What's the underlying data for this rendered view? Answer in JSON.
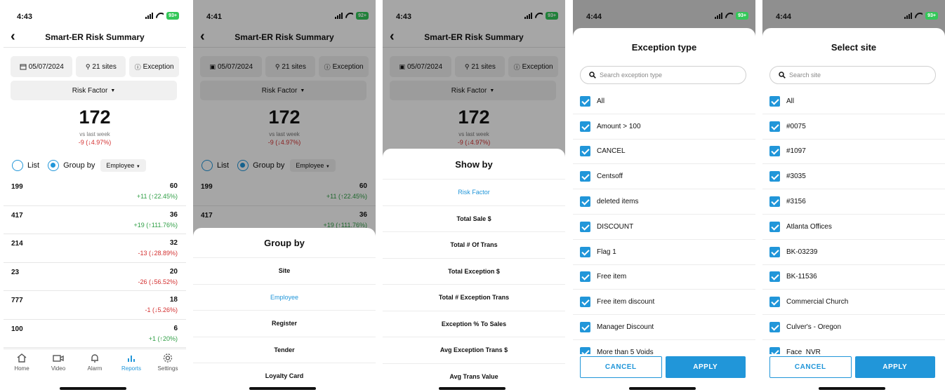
{
  "screen1": {
    "status": {
      "time": "4:43",
      "battery": "93+"
    },
    "nav": {
      "title": "Smart-ER Risk Summary"
    },
    "filters": {
      "date": "05/07/2024",
      "sites": "21 sites",
      "exception": "Exception"
    },
    "risk_factor": "Risk Factor",
    "total": "172",
    "vs_label": "vs last week",
    "delta": "-9 (↓4.97%)",
    "list_label": "List",
    "group_by_label": "Group by",
    "group_by_value": "Employee",
    "rows": [
      {
        "id": "199",
        "count": "60",
        "change": "+11 (↑22.45%)",
        "trend": "up"
      },
      {
        "id": "417",
        "count": "36",
        "change": "+19 (↑111.76%)",
        "trend": "up"
      },
      {
        "id": "214",
        "count": "32",
        "change": "-13 (↓28.89%)",
        "trend": "down"
      },
      {
        "id": "23",
        "count": "20",
        "change": "-26 (↓56.52%)",
        "trend": "down"
      },
      {
        "id": "777",
        "count": "18",
        "change": "-1 (↓5.26%)",
        "trend": "down"
      },
      {
        "id": "100",
        "count": "6",
        "change": "+1 (↑20%)",
        "trend": "up"
      }
    ],
    "tabs": [
      "Home",
      "Video",
      "Alarm",
      "Reports",
      "Settings"
    ],
    "active_tab": "Reports"
  },
  "screen2": {
    "status": {
      "time": "4:41",
      "battery": "92+"
    },
    "nav": {
      "title": "Smart-ER Risk Summary"
    },
    "filters": {
      "date": "05/07/2024",
      "sites": "21 sites",
      "exception": "Exception"
    },
    "risk_factor": "Risk Factor",
    "total": "172",
    "vs_label": "vs last week",
    "delta": "-9 (↓4.97%)",
    "list_label": "List",
    "group_by_label": "Group by",
    "group_by_value": "Employee",
    "rows": [
      {
        "id": "199",
        "count": "60",
        "change": "+11 (↑22.45%)",
        "trend": "up"
      },
      {
        "id": "417",
        "count": "36",
        "change": "+19 (↑111.76%)",
        "trend": "up"
      }
    ],
    "sheet": {
      "title": "Group by",
      "options": [
        "Site",
        "Employee",
        "Register",
        "Tender",
        "Loyalty Card"
      ],
      "selected": "Employee"
    }
  },
  "screen3": {
    "status": {
      "time": "4:43",
      "battery": "93+"
    },
    "nav": {
      "title": "Smart-ER Risk Summary"
    },
    "filters": {
      "date": "05/07/2024",
      "sites": "21 sites",
      "exception": "Exception"
    },
    "risk_factor": "Risk Factor",
    "total": "172",
    "vs_label": "vs last week",
    "delta": "-9 (↓4.97%)",
    "sheet": {
      "title": "Show by",
      "options": [
        "Risk Factor",
        "Total Sale $",
        "Total # Of Trans",
        "Total Exception $",
        "Total # Exception Trans",
        "Exception % To Sales",
        "Avg Exception Trans $",
        "Avg Trans Value"
      ],
      "selected": "Risk Factor"
    }
  },
  "screen4": {
    "status": {
      "time": "4:44",
      "battery": "93+"
    },
    "title": "Exception type",
    "search_placeholder": "Search exception type",
    "items": [
      "All",
      "Amount > 100",
      "CANCEL",
      "Centsoff",
      "deleted items",
      "DISCOUNT",
      "Flag 1",
      "Free item",
      "Free item discount",
      "Manager Discount",
      "More than 5 Voids"
    ],
    "cancel": "CANCEL",
    "apply": "APPLY"
  },
  "screen5": {
    "status": {
      "time": "4:44",
      "battery": "93+"
    },
    "title": "Select site",
    "search_placeholder": "Search site",
    "items": [
      "All",
      "#0075",
      "#1097",
      "#3035",
      "#3156",
      "Atlanta Offices",
      "BK-03239",
      "BK-11536",
      "Commercial Church",
      "Culver's - Oregon",
      "Face_NVR"
    ],
    "cancel": "CANCEL",
    "apply": "APPLY"
  },
  "colors": {
    "accent": "#2196d9",
    "up": "#2e9e44",
    "down": "#d32f2f"
  }
}
